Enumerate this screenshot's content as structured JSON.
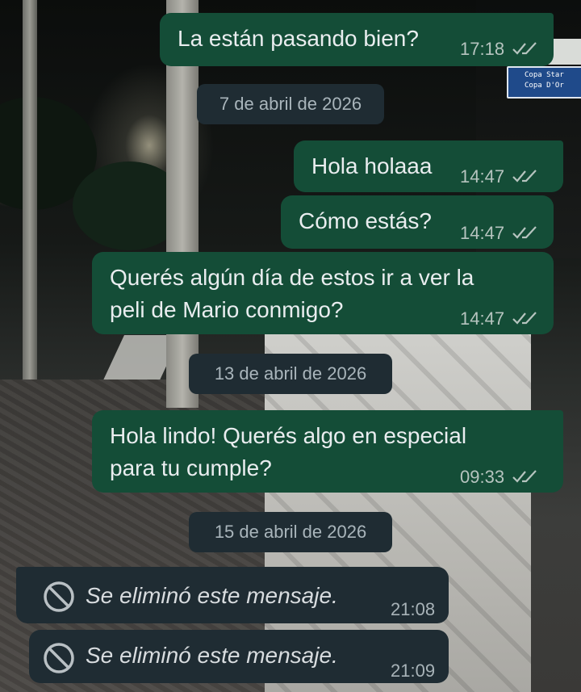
{
  "background": {
    "sign_lines": [
      "Copa Star",
      "Copa D'Or"
    ]
  },
  "messages": [
    {
      "id": "m1",
      "text": "La están pasando bien?",
      "time": "17:18",
      "direction": "outgoing",
      "status": "read"
    },
    {
      "id": "m2",
      "text": "Hola holaaa",
      "time": "14:47",
      "direction": "outgoing",
      "status": "read"
    },
    {
      "id": "m3",
      "text": "Cómo estás?",
      "time": "14:47",
      "direction": "outgoing",
      "status": "read"
    },
    {
      "id": "m4",
      "text": "Querés algún día de estos ir a ver la\npeli de Mario conmigo?",
      "time": "14:47",
      "direction": "outgoing",
      "status": "read"
    },
    {
      "id": "m5",
      "text": "Hola lindo! Querés algo en especial\npara tu cumple?",
      "time": "09:33",
      "direction": "outgoing",
      "status": "read"
    },
    {
      "id": "m6",
      "text": "Se eliminó este mensaje.",
      "time": "21:08",
      "direction": "incoming",
      "deleted": true
    },
    {
      "id": "m7",
      "text": "Se eliminó este mensaje.",
      "time": "21:09",
      "direction": "incoming",
      "deleted": true
    }
  ],
  "date_dividers": [
    "7 de abril de 2026",
    "13 de abril de 2026",
    "15 de abril de 2026"
  ],
  "colors": {
    "outgoing_bubble": "#144d37",
    "incoming_bubble": "#1f2c33",
    "read_ticks": "#b6c4bf",
    "text": "#e9edef"
  }
}
